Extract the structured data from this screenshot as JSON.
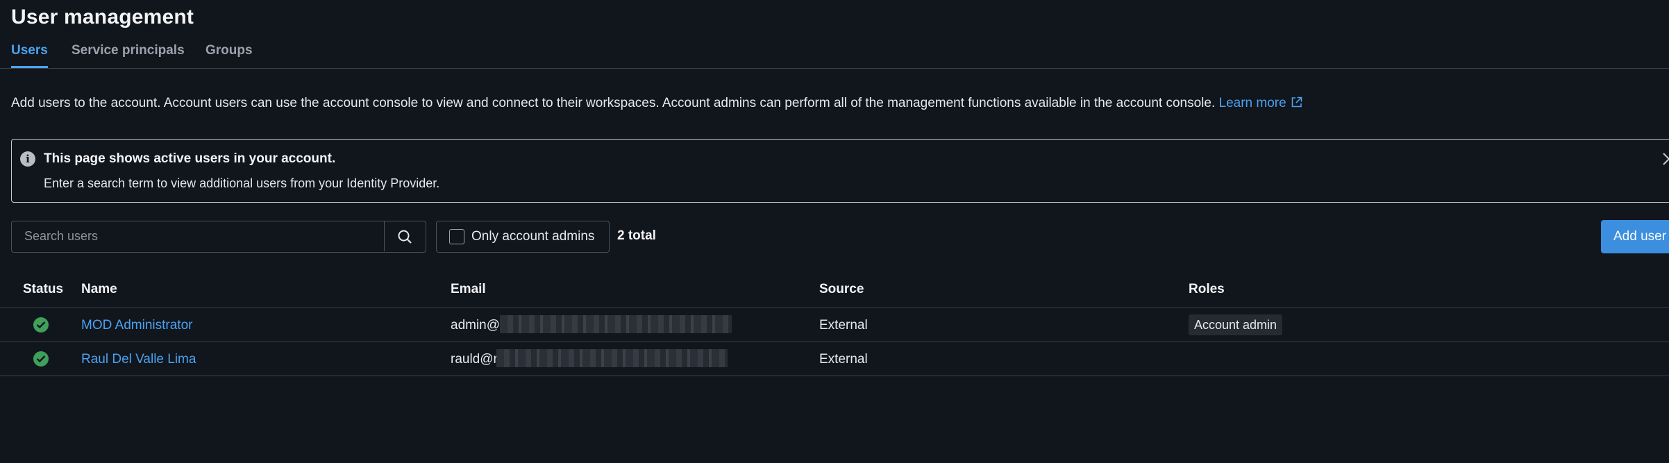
{
  "page": {
    "title": "User management"
  },
  "tabs": [
    {
      "label": "Users",
      "active": true
    },
    {
      "label": "Service principals",
      "active": false
    },
    {
      "label": "Groups",
      "active": false
    }
  ],
  "description": {
    "text": "Add users to the account. Account users can use the account console to view and connect to their workspaces. Account admins can perform all of the management functions available in the account console.",
    "link_label": "Learn more",
    "link_icon": "external-link-icon"
  },
  "banner": {
    "icon": "info-icon",
    "title": "This page shows active users in your account.",
    "text": "Enter a search term to view additional users from your Identity Provider.",
    "close_icon": "close-icon"
  },
  "toolbar": {
    "search_placeholder": "Search users",
    "search_icon": "search-icon",
    "admin_filter_label": "Only account admins",
    "admin_filter_checked": false,
    "total_label": "2 total",
    "add_user_label": "Add user"
  },
  "table": {
    "columns": [
      "Status",
      "Name",
      "Email",
      "Source",
      "Roles"
    ],
    "rows": [
      {
        "status": "active",
        "status_icon": "check-circle-icon",
        "name": "MOD Administrator",
        "email_visible": "admin@",
        "source": "External",
        "roles": [
          "Account admin"
        ]
      },
      {
        "status": "active",
        "status_icon": "check-circle-icon",
        "name": "Raul Del Valle Lima",
        "email_visible": "rauld@r",
        "source": "External",
        "roles": []
      }
    ]
  },
  "colors": {
    "background": "#11151c",
    "accent": "#4aa3f0",
    "primary_button": "#3b8fde",
    "status_active": "#3fa05b",
    "border": "#3a414b"
  }
}
